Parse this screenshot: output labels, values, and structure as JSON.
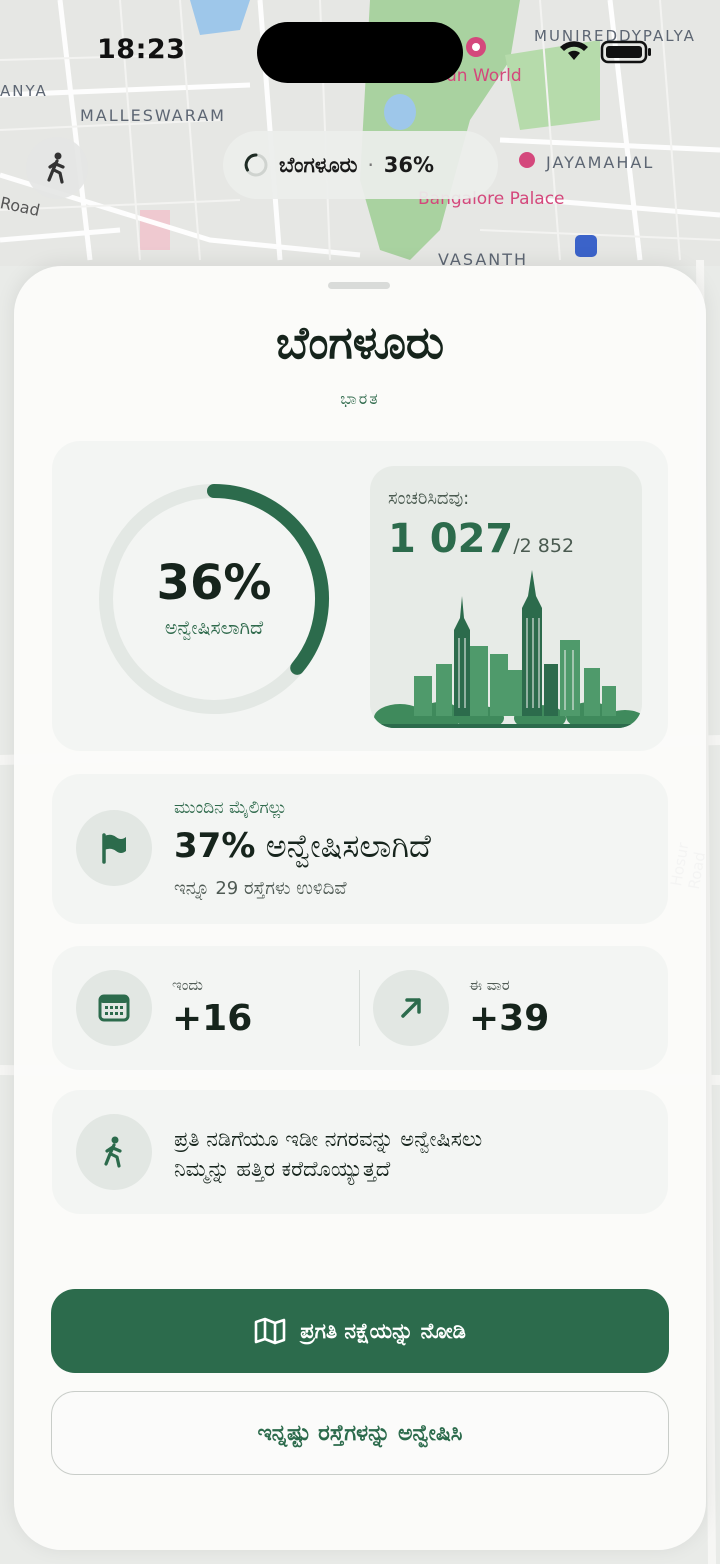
{
  "status_bar": {
    "time": "18:23"
  },
  "map": {
    "labels": {
      "malleswaram": "MALLESWARAM",
      "munireddypalya": "MUNIREDDYPALYA",
      "jayamahal": "JAYAMAHAL",
      "vasanth": "VASANTH",
      "fun_world": "un World",
      "bangalore_palace": "Bangalore Palace",
      "road": "Road",
      "anya": "ANYA",
      "hosur_road": "Hosur Road"
    }
  },
  "top_bar": {
    "city": "ಬೆಂಗಳೂರು",
    "separator": "·",
    "percent": "36%"
  },
  "sheet": {
    "title": "ಬೆಂಗಳೂರು",
    "country": "ಭಾರತ",
    "progress": {
      "percent_label": "36%",
      "percent_value": 0.36,
      "explored_label": "ಅನ್ವೇಷಿಸಲಾಗಿದೆ",
      "traveled_label": "ಸಂಚರಿಸಿದವು:",
      "traveled_count": "1 027",
      "traveled_total": "/2 852"
    },
    "milestone": {
      "label": "ಮುಂದಿನ ಮೈಲಿಗಲ್ಲು",
      "percent": "37%",
      "explored": "ಅನ್ವೇಷಿಸಲಾಗಿದೆ",
      "remaining": "ಇನ್ನೂ 29 ರಸ್ತೆಗಳು ಉಳಿದಿವೆ"
    },
    "stats": {
      "today_label": "ಇಂದು",
      "today_value": "+16",
      "week_label": "ಈ ವಾರ",
      "week_value": "+39"
    },
    "motivation": {
      "line1": "ಪ್ರತಿ ನಡಿಗೆಯೂ ಇಡೀ ನಗರವನ್ನು ಅನ್ವೇಷಿಸಲು",
      "line2": "ನಿಮ್ಮನ್ನು ಹತ್ತಿರ ಕರೆದೊಯ್ಯುತ್ತದೆ"
    },
    "buttons": {
      "view_map": "ಪ್ರಗತಿ ನಕ್ಷೆಯನ್ನು ನೋಡಿ",
      "explore_more": "ಇನ್ನಷ್ಟು ರಸ್ತೆಗಳನ್ನು ಅನ್ವೇಷಿಸಿ"
    }
  },
  "colors": {
    "accent": "#2c6b4c",
    "ring_track": "#e3e8e4",
    "card_bg": "#f3f5f3",
    "sheet_bg": "#fbfbfa"
  },
  "icons": {
    "walk_button": "walking-person-icon",
    "spinner": "progress-spinner-icon",
    "milestone": "flag-icon",
    "today": "calendar-icon",
    "week": "arrow-up-right-icon",
    "motivation": "walking-person-icon",
    "view_map": "map-icon"
  }
}
